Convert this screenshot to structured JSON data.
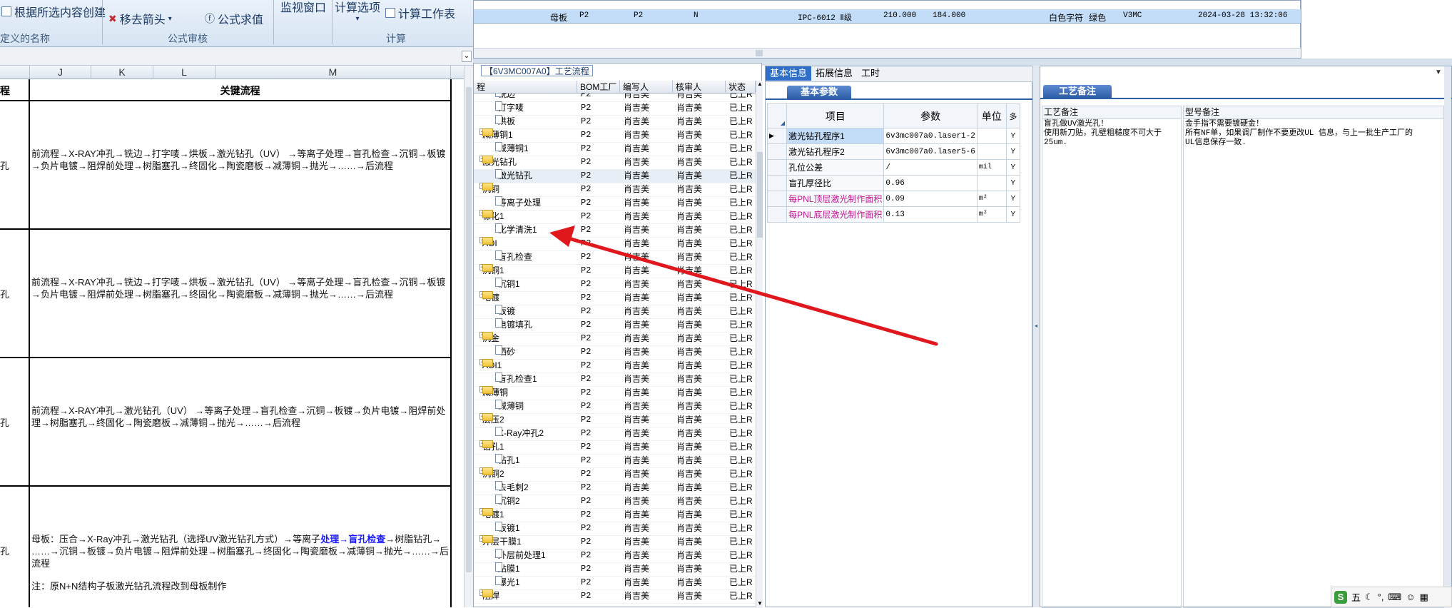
{
  "ribbon": {
    "btn_create_from_selection": "根据所选内容创建",
    "btn_remove_arrows": "移去箭头",
    "btn_evaluate_formula": "公式求值",
    "btn_watch_window": "监视窗口",
    "btn_calc_options": "计算选项",
    "btn_calc_sheet": "计算工作表",
    "group_defined_names": "定义的名称",
    "group_formula_audit": "公式审核",
    "group_calc": "计算"
  },
  "sheet": {
    "columns": [
      "J",
      "K",
      "L",
      "M"
    ],
    "header_key_flow": "关键流程",
    "header_left": "程",
    "row_left_labels": [
      "孔",
      "孔",
      "孔",
      "孔"
    ],
    "rows": [
      {
        "lines": [
          "前流程→X-RAY冲孔→铣边→打字唛→烘板→激光钻孔（UV） →等离子处理→盲孔检查→沉铜→板镀",
          "→负片电镀→阻焊前处理→树脂塞孔→终固化→陶瓷磨板→减薄铜→抛光→……→后流程"
        ]
      },
      {
        "lines": [
          "前流程→X-RAY冲孔→铣边→打字唛→烘板→激光钻孔（UV） →等离子处理→盲孔检查→沉铜→板镀",
          "→负片电镀→阻焊前处理→树脂塞孔→终固化→陶瓷磨板→减薄铜→抛光→……→后流程"
        ]
      },
      {
        "lines": [
          "前流程→X-RAY冲孔→激光钻孔（UV） →等离子处理→盲孔检查→沉铜→板镀→负片电镀→阻焊前处",
          "理→树脂塞孔→终固化→陶瓷磨板→减薄铜→抛光→……→后流程"
        ]
      },
      {
        "line1_a": "母板：压合→X-Ray冲孔→激光钻孔（选择UV激光钻孔方式）→等离子",
        "line1_b": "处理→盲孔检查",
        "line1_c": "→树脂钻孔→",
        "line2": "……→沉铜→板镀→负片电镀→阻焊前处理→树脂塞孔→终固化→陶瓷磨板→减薄铜→抛光→……→后流程",
        "note": "注：原N+N结构子板激光钻孔流程改到母板制作"
      }
    ]
  },
  "topgrid": {
    "row": [
      "母板",
      "P2",
      "P2",
      "N",
      "IPC-6012 Ⅱ级",
      "210.000",
      "184.000",
      "白色字符",
      "绿色",
      "V3MC",
      "2024-03-28 13:32:06"
    ]
  },
  "process_panel": {
    "title": "【6V3MC007A0】工艺流程",
    "headers": [
      "程",
      "BOM工厂",
      "编写人",
      "核审人",
      "状态"
    ],
    "factory": "P2",
    "author": "肖吉美",
    "reviewer": "肖吉美",
    "status": "已上R",
    "rows": [
      {
        "level": 2,
        "name": "铣边"
      },
      {
        "level": 2,
        "name": "打字唛"
      },
      {
        "level": 2,
        "name": "烘板"
      },
      {
        "level": 1,
        "name": "减薄铜1"
      },
      {
        "level": 2,
        "name": "减薄铜1"
      },
      {
        "level": 1,
        "name": "激光钻孔"
      },
      {
        "level": 2,
        "name": "激光钻孔"
      },
      {
        "level": 1,
        "name": "沉铜"
      },
      {
        "level": 2,
        "name": "等离子处理"
      },
      {
        "level": 1,
        "name": "棕化1"
      },
      {
        "level": 2,
        "name": "化学清洗1"
      },
      {
        "level": 1,
        "name": "AOI"
      },
      {
        "level": 2,
        "name": "盲孔检查"
      },
      {
        "level": 1,
        "name": "沉铜1"
      },
      {
        "level": 2,
        "name": "沉铜1"
      },
      {
        "level": 1,
        "name": "电镀"
      },
      {
        "level": 2,
        "name": "板镀"
      },
      {
        "level": 2,
        "name": "电镀填孔"
      },
      {
        "level": 1,
        "name": "沉金"
      },
      {
        "level": 2,
        "name": "晒砂"
      },
      {
        "level": 1,
        "name": "AOI1"
      },
      {
        "level": 2,
        "name": "盲孔检查1"
      },
      {
        "level": 1,
        "name": "减薄铜"
      },
      {
        "level": 2,
        "name": "减薄铜"
      },
      {
        "level": 1,
        "name": "层压2"
      },
      {
        "level": 2,
        "name": "X-Ray冲孔2"
      },
      {
        "level": 1,
        "name": "钻孔1"
      },
      {
        "level": 2,
        "name": "钻孔1"
      },
      {
        "level": 1,
        "name": "沉铜2"
      },
      {
        "level": 2,
        "name": "去毛刺2"
      },
      {
        "level": 2,
        "name": "沉铜2"
      },
      {
        "level": 1,
        "name": "电镀1"
      },
      {
        "level": 2,
        "name": "板镀1"
      },
      {
        "level": 1,
        "name": "外层干膜1"
      },
      {
        "level": 2,
        "name": "外层前处理1"
      },
      {
        "level": 2,
        "name": "贴膜1"
      },
      {
        "level": 2,
        "name": "曝光1"
      },
      {
        "level": 1,
        "name": "阻焊"
      }
    ]
  },
  "info_panel": {
    "tabs": [
      "基本信息",
      "拓展信息",
      "工时"
    ],
    "section_title": "基本参数",
    "headers": [
      "项目",
      "参数",
      "单位",
      "多"
    ],
    "rows": [
      {
        "item": "激光钻孔程序1",
        "param": "6v3mc007a0.laser1-2",
        "unit": "",
        "flag": "Y",
        "pink": false
      },
      {
        "item": "激光钻孔程序2",
        "param": "6v3mc007a0.laser5-6",
        "unit": "",
        "flag": "Y",
        "pink": false
      },
      {
        "item": "孔位公差",
        "param": "/",
        "unit": "mil",
        "flag": "Y",
        "pink": false
      },
      {
        "item": "盲孔厚径比",
        "param": "0.96",
        "unit": "",
        "flag": "Y",
        "pink": false
      },
      {
        "item": "每PNL顶层激光制作面积",
        "param": "0.09",
        "unit": "m²",
        "flag": "Y",
        "pink": true
      },
      {
        "item": "每PNL底层激光制作面积",
        "param": "0.13",
        "unit": "m²",
        "flag": "Y",
        "pink": true
      }
    ]
  },
  "remarks_panel": {
    "section_title": "工艺备注",
    "col1_header": "工艺备注",
    "col2_header": "型号备注",
    "col1_text": [
      "盲孔做UV激光孔！",
      "使用新刀贴，孔壁粗糙度不可大于",
      "25um."
    ],
    "col2_text": [
      "金手指不需要镀硬金！",
      "所有NF单，如果调厂制作不要更改UL 信息，与上一批生产工厂的",
      "UL信息保存一致."
    ]
  },
  "taskbar": {
    "ime_label": "五"
  },
  "colors": {
    "arrow": "#e0181e",
    "highlight_text": "#1a1aff",
    "tab_active": "#2f6fc8"
  }
}
